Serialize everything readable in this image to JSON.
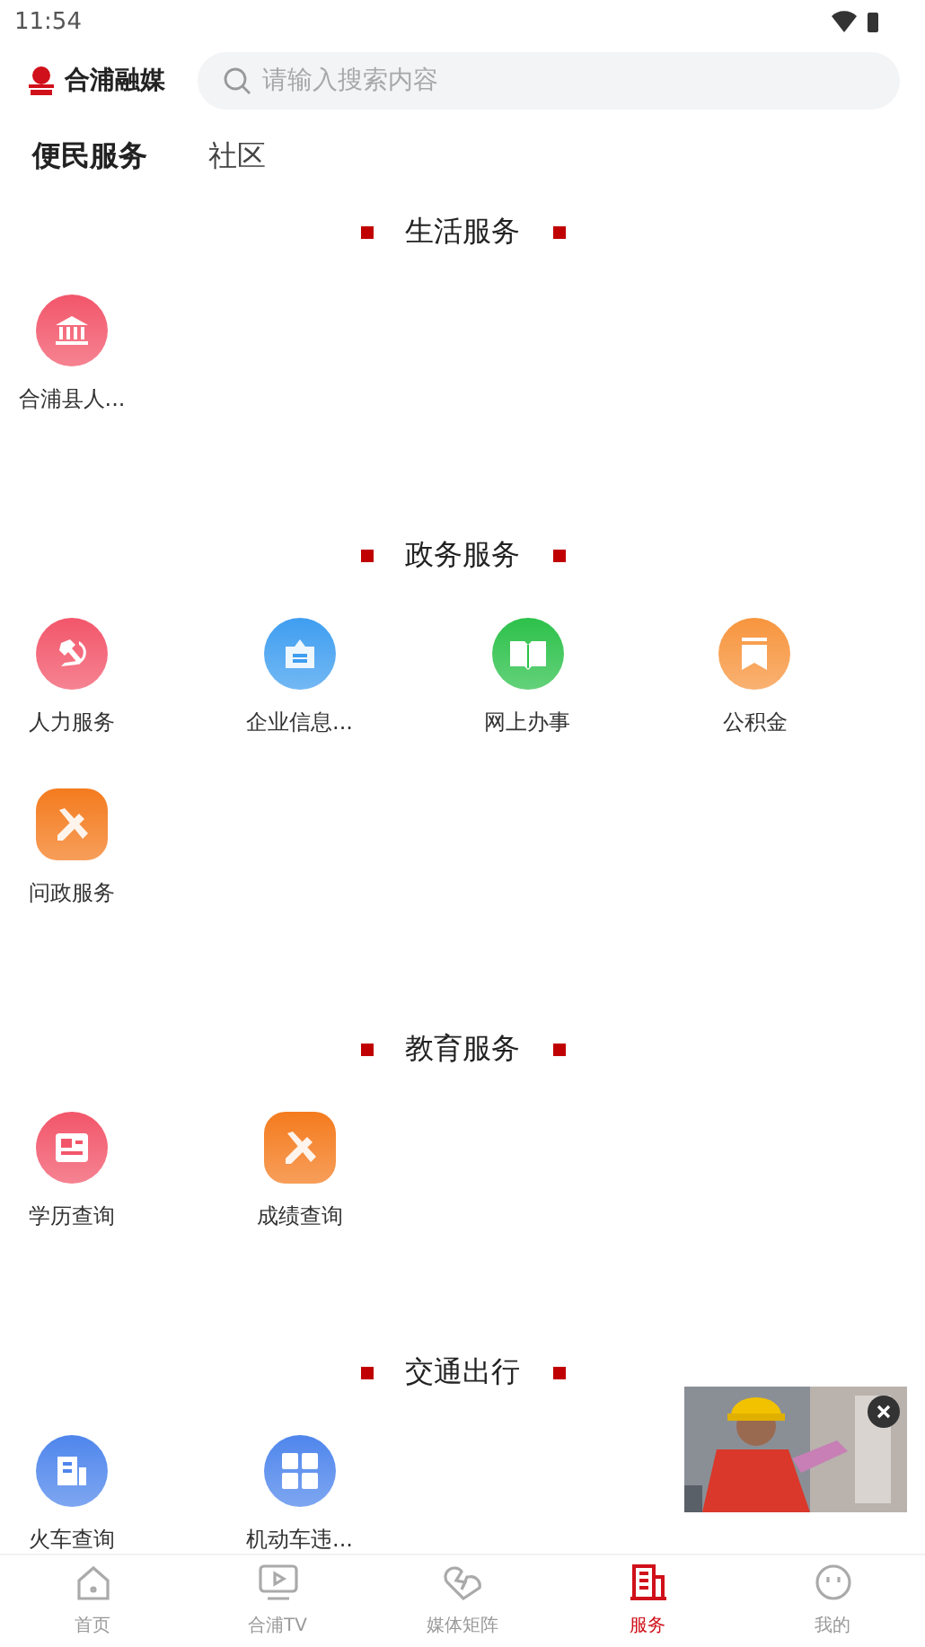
{
  "status_bar": {
    "time": "11:54"
  },
  "header": {
    "logo_text": "合浦融媒",
    "search": {
      "placeholder": "请输入搜索内容"
    }
  },
  "tabs": [
    {
      "label": "便民服务",
      "selected": true
    },
    {
      "label": "社区",
      "selected": false
    }
  ],
  "sections": [
    {
      "title": "生活服务",
      "items": [
        {
          "label": "合浦县人...",
          "kind": "bank",
          "rounded": false,
          "color": "#f2566a"
        }
      ]
    },
    {
      "title": "政务服务",
      "items": [
        {
          "label": "人力服务",
          "kind": "emblem",
          "rounded": false,
          "color": "#f2566a"
        },
        {
          "label": "企业信息...",
          "kind": "sign",
          "rounded": false,
          "color": "#3f9ef0"
        },
        {
          "label": "网上办事",
          "kind": "book",
          "rounded": false,
          "color": "#2cc14a"
        },
        {
          "label": "公积金",
          "kind": "bookmark",
          "rounded": false,
          "color": "#f7953e"
        },
        {
          "label": "问政服务",
          "kind": "pencil",
          "rounded": true,
          "color": "#f47b1e"
        }
      ]
    },
    {
      "title": "教育服务",
      "items": [
        {
          "label": "学历查询",
          "kind": "form",
          "rounded": false,
          "color": "#f2566a"
        },
        {
          "label": "成绩查询",
          "kind": "pencil",
          "rounded": true,
          "color": "#f47b1e"
        }
      ]
    },
    {
      "title": "交通出行",
      "items": [
        {
          "label": "火车查询",
          "kind": "building",
          "rounded": false,
          "color": "#4f86ec"
        },
        {
          "label": "机动车违...",
          "kind": "grid",
          "rounded": false,
          "color": "#4f86ec"
        }
      ]
    }
  ],
  "bottom_nav": [
    {
      "label": "首页",
      "kind": "home",
      "selected": false
    },
    {
      "label": "合浦TV",
      "kind": "tv",
      "selected": false
    },
    {
      "label": "媒体矩阵",
      "kind": "heart",
      "selected": false
    },
    {
      "label": "服务",
      "kind": "building",
      "selected": true
    },
    {
      "label": "我的",
      "kind": "face",
      "selected": false
    }
  ]
}
